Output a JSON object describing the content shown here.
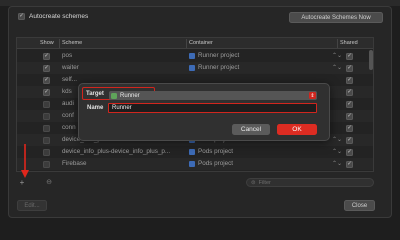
{
  "header": {
    "autocreate_label": "Autocreate schemes",
    "autocreate_checked": true,
    "autocreate_button": "Autocreate Schemes Now"
  },
  "table": {
    "columns": {
      "show": "Show",
      "scheme": "Scheme",
      "container": "Container",
      "shared": "Shared"
    },
    "rows": [
      {
        "show": true,
        "scheme": "pos",
        "container": "Runner project",
        "shared": true
      },
      {
        "show": true,
        "scheme": "waiter",
        "container": "Runner project",
        "shared": true
      },
      {
        "show": true,
        "scheme": "self...",
        "container": "",
        "shared": true
      },
      {
        "show": true,
        "scheme": "kds",
        "container": "",
        "shared": true
      },
      {
        "show": false,
        "scheme": "audi",
        "container": "",
        "shared": true
      },
      {
        "show": false,
        "scheme": "conf",
        "container": "",
        "shared": true
      },
      {
        "show": false,
        "scheme": "conn",
        "container": "",
        "shared": true
      },
      {
        "show": false,
        "scheme": "device_info_plus",
        "container": "Pods project",
        "shared": true
      },
      {
        "show": false,
        "scheme": "device_info_plus-device_info_plus_p...",
        "container": "Pods project",
        "shared": true
      },
      {
        "show": false,
        "scheme": "Firebase",
        "container": "Pods project",
        "shared": true
      }
    ]
  },
  "footer": {
    "add_icon": "plus-icon",
    "remove_icon": "minus-icon",
    "filter_placeholder": "Filter",
    "edit_button": "Edit...",
    "close_button": "Close"
  },
  "dialog": {
    "target_label": "Target",
    "target_value": "Runner",
    "name_label": "Name",
    "name_value": "Runner",
    "cancel_button": "Cancel",
    "ok_button": "OK",
    "accent_color": "#dd2c22"
  }
}
